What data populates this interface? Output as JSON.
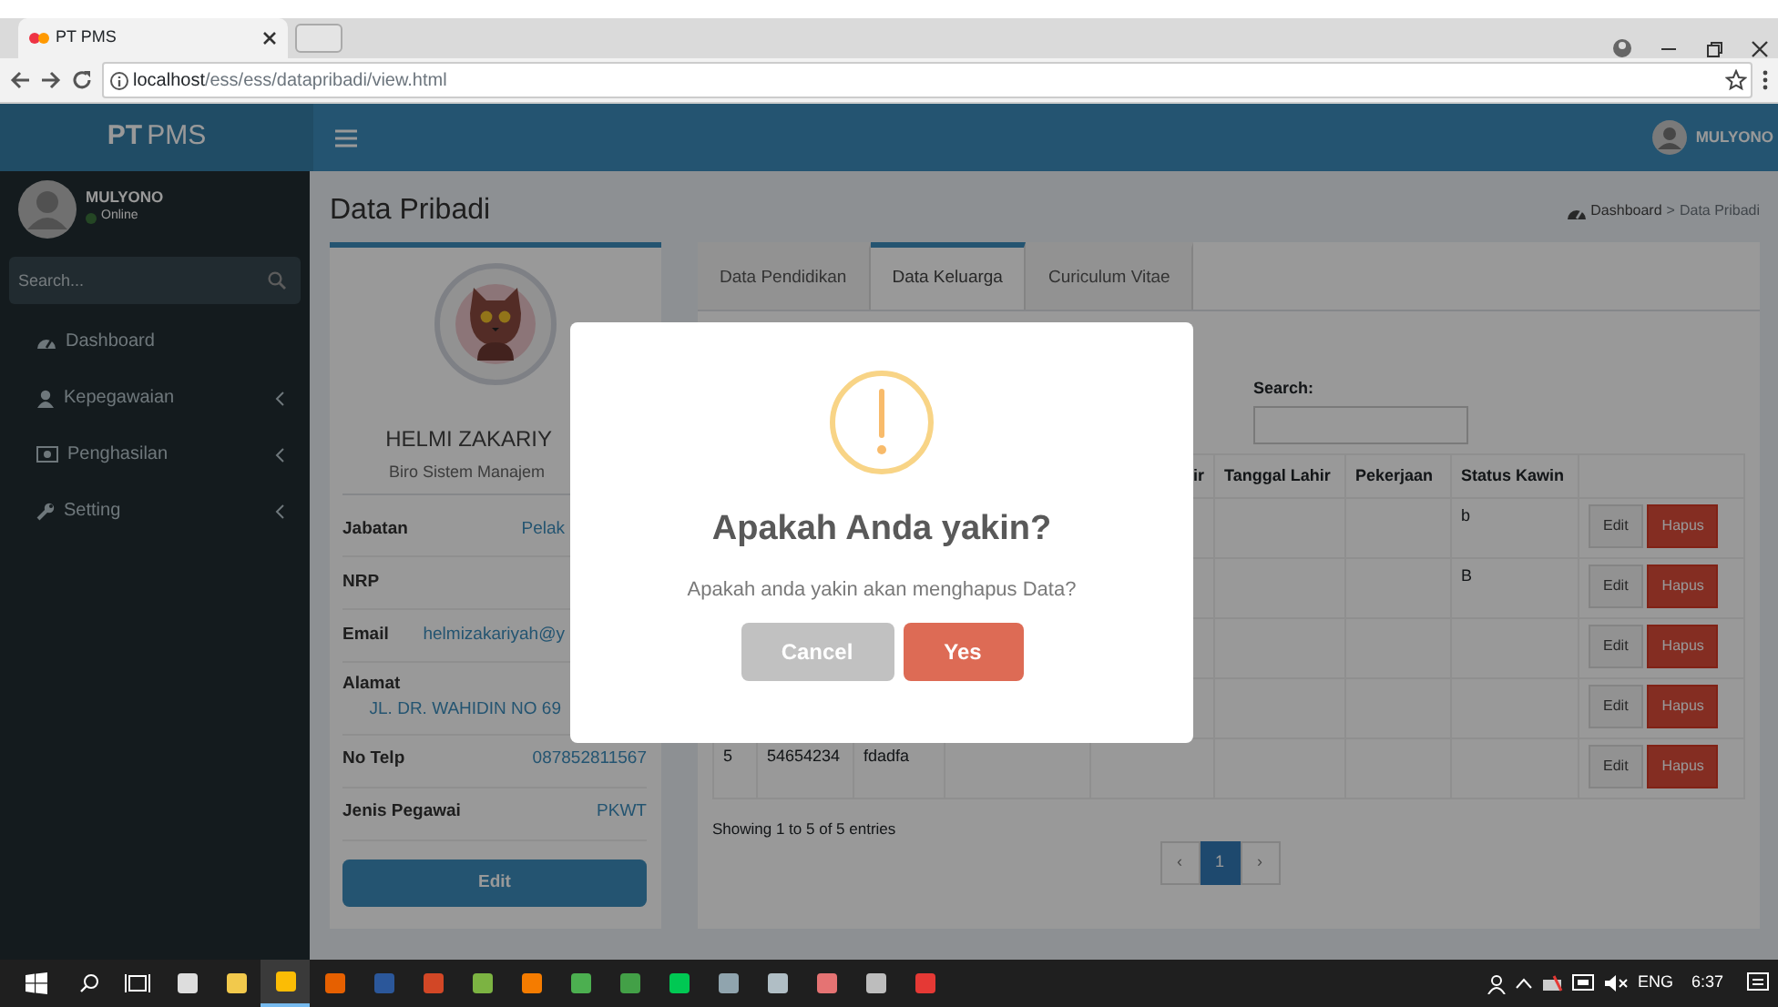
{
  "browser": {
    "tab_title": "PT PMS",
    "url_host": "localhost",
    "url_path": "/ess/ess/datapribadi/view.html"
  },
  "header": {
    "logo_bold": "PT",
    "logo_rest": "PMS",
    "user_name": "MULYONO"
  },
  "sidebar": {
    "user_name": "MULYONO",
    "status": "Online",
    "search": {
      "placeholder": "Search..."
    },
    "items": [
      {
        "label": "Dashboard",
        "expandable": false
      },
      {
        "label": "Kepegawaian",
        "expandable": true
      },
      {
        "label": "Penghasilan",
        "expandable": true
      },
      {
        "label": "Setting",
        "expandable": true
      }
    ]
  },
  "page": {
    "title": "Data Pribadi",
    "breadcrumb": {
      "items": [
        "Dashboard",
        "Data Pribadi"
      ],
      "separator": ">"
    }
  },
  "profile": {
    "name": "HELMI ZAKARIY",
    "unit": "Biro Sistem Manajem",
    "fields": [
      {
        "label": "Jabatan",
        "value": "Pelak",
        "kind": "cut"
      },
      {
        "label": "NRP",
        "kind": "inline"
      },
      {
        "label": "Email",
        "value": "helmizakariyah@y",
        "kind": "cut"
      },
      {
        "label": "Alamat",
        "value": "JL. DR. WAHIDIN NO 69",
        "kind": "stacked"
      },
      {
        "label": "No Telp",
        "value": "087852811567",
        "kind": "inline"
      },
      {
        "label": "Jenis Pegawai",
        "value": "PKWT",
        "kind": "inline"
      }
    ],
    "edit_button": "Edit"
  },
  "tabs": [
    {
      "label": "Data Pendidikan",
      "selected": false
    },
    {
      "label": "Data Keluarga",
      "selected": true
    },
    {
      "label": "Curiculum Vitae",
      "selected": false
    }
  ],
  "search_label": "Search:",
  "table": {
    "columns": [
      "ir",
      "Tanggal Lahir",
      "Pekerjaan",
      "Status Kawin"
    ],
    "rows": [
      {
        "status_kawin": "b",
        "actions": [
          "Edit",
          "Hapus"
        ]
      },
      {
        "status_kawin": "B",
        "actions": [
          "Edit",
          "Hapus"
        ]
      },
      {
        "actions": [
          "Edit",
          "Hapus"
        ]
      },
      {
        "actions": [
          "Edit",
          "Hapus"
        ]
      },
      {
        "column_1": "5",
        "column_2": "54654234",
        "column_3": "fdadfa",
        "actions": [
          "Edit",
          "Hapus"
        ]
      }
    ]
  },
  "info": "Showing 1 to 5 of 5 entries",
  "pagination": {
    "prev": "‹",
    "pages": [
      {
        "label": "1",
        "selected": true
      }
    ],
    "next": "›"
  },
  "dialog": {
    "title": "Apakah Anda yakin?",
    "text": "Apakah anda yakin akan menghapus Data?",
    "buttons": [
      {
        "label": "Cancel",
        "kind": "cancel"
      },
      {
        "label": "Yes",
        "kind": "confirm"
      }
    ]
  },
  "taskbar": {
    "language": "ENG",
    "time": "6:37"
  }
}
